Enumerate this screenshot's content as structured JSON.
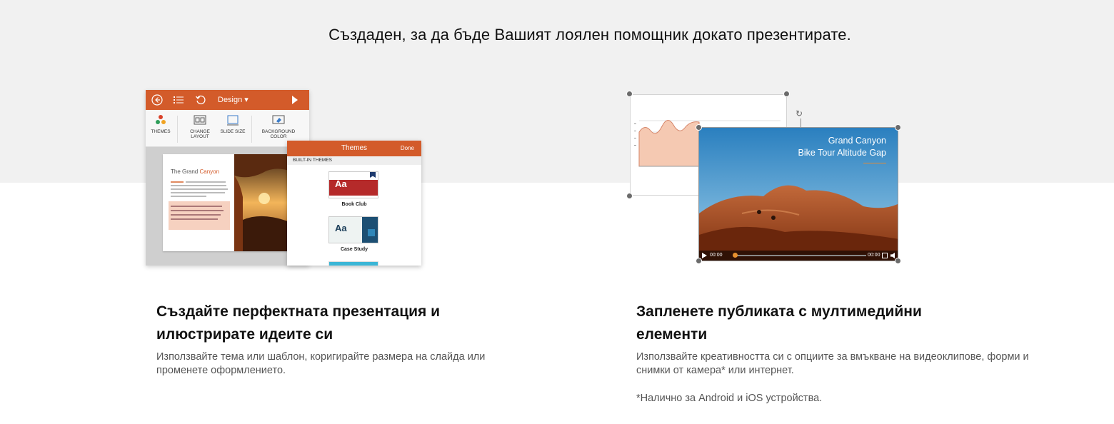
{
  "headline": "Създаден, за да бъде Вашият лоялен помощник докато презентирате.",
  "left_illustration": {
    "toolbar": {
      "back_icon": "back-circle-icon",
      "list_icon": "list-icon",
      "undo_icon": "undo-icon",
      "menu_label": "Design",
      "play_icon": "play-icon"
    },
    "ribbon": [
      {
        "label": "THEMES",
        "icon": "themes-icon"
      },
      {
        "label": "CHANGE LAYOUT",
        "icon": "layout-icon"
      },
      {
        "label": "SLIDE SIZE",
        "icon": "slide-size-icon"
      },
      {
        "label": "BACKGROUND COLOR",
        "icon": "paint-bucket-icon"
      }
    ],
    "slide": {
      "title_prefix": "The Grand ",
      "title_accent": "Canyon"
    },
    "themes_panel": {
      "title": "Themes",
      "done_label": "Done",
      "section_label": "BUILT-IN THEMES",
      "items": [
        {
          "name": "Book Club",
          "sample": "Aa"
        },
        {
          "name": "Case Study",
          "sample": "Aa"
        }
      ]
    }
  },
  "right_illustration": {
    "video": {
      "title_line1": "Grand Canyon",
      "title_line2": "Bike Tour Altitude Gap",
      "time_current": "00:00",
      "time_total": "00:00"
    }
  },
  "columns": [
    {
      "heading": "Създайте перфектната презентация и илюстрирате идеите си",
      "body": "Използвайте тема или шаблон, коригирайте размера на слайда или променете оформлението."
    },
    {
      "heading": "Запленете публиката с мултимедийни елементи",
      "body": "Използвайте креативността си с опциите за вмъкване на видеоклипове, форми и снимки от камера* или интернет.",
      "note": "*Налично за Android и iOS устройства."
    }
  ],
  "colors": {
    "accent": "#d35b2a",
    "band": "#f1f1f1"
  }
}
